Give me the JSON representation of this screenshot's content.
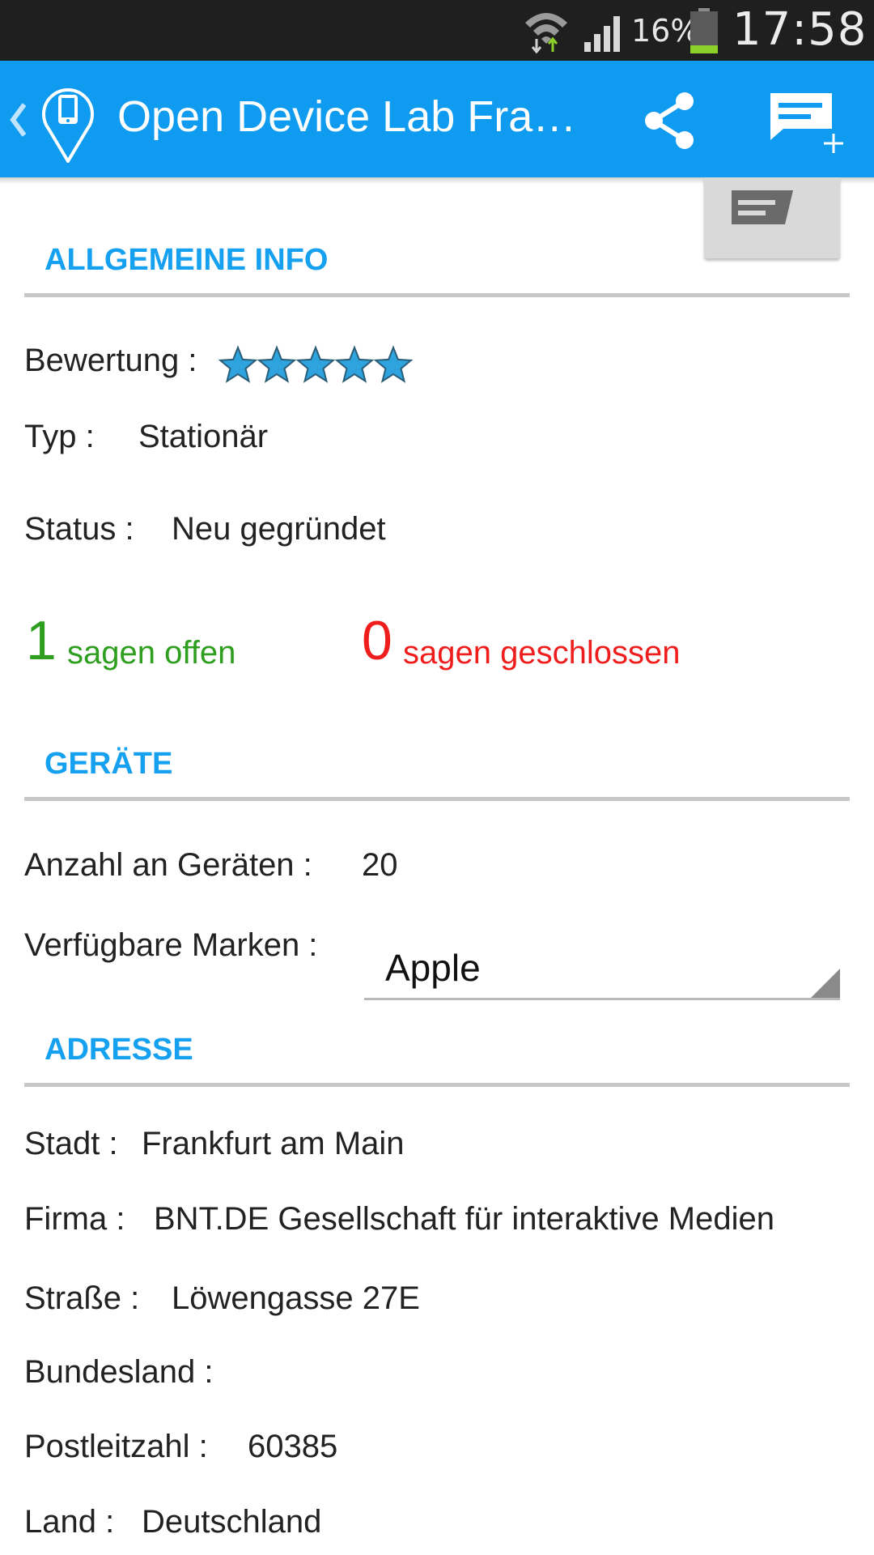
{
  "status_bar": {
    "battery_percent": "16%",
    "time": "17:58",
    "icons": [
      "wifi-icon",
      "signal-icon",
      "battery-icon"
    ]
  },
  "action_bar": {
    "title": "Open Device Lab Fran…",
    "icons": [
      "back-chevron-icon",
      "app-logo-icon",
      "share-icon",
      "add-comment-icon"
    ]
  },
  "sections": {
    "general": {
      "heading": "ALLGEMEINE INFO",
      "rating_label": "Bewertung :",
      "rating_stars": 5,
      "type_label": "Typ :",
      "type_value": "Stationär",
      "status_label": "Status :",
      "status_value": "Neu gegründet",
      "open_count": "1",
      "open_label": "sagen offen",
      "closed_count": "0",
      "closed_label": "sagen geschlossen"
    },
    "devices": {
      "heading": "GERÄTE",
      "count_label": "Anzahl an Geräten :",
      "count_value": "20",
      "brands_label": "Verfügbare Marken :",
      "brands_selected": "Apple"
    },
    "address": {
      "heading": "ADRESSE",
      "city_label": "Stadt :",
      "city_value": "Frankfurt am Main",
      "company_label": "Firma :",
      "company_value": "BNT.DE Gesellschaft für interaktive Medien",
      "street_label": "Straße :",
      "street_value": "Löwengasse 27E",
      "state_label": "Bundesland :",
      "state_value": "",
      "zip_label": "Postleitzahl :",
      "zip_value": "60385",
      "country_label": "Land :",
      "country_value": "Deutschland"
    }
  },
  "colors": {
    "action_bar": "#0f9bef",
    "section_heading": "#16a0f0",
    "open": "#2e9e1f",
    "closed": "#f01d1d",
    "star": "#2ea3dd"
  }
}
